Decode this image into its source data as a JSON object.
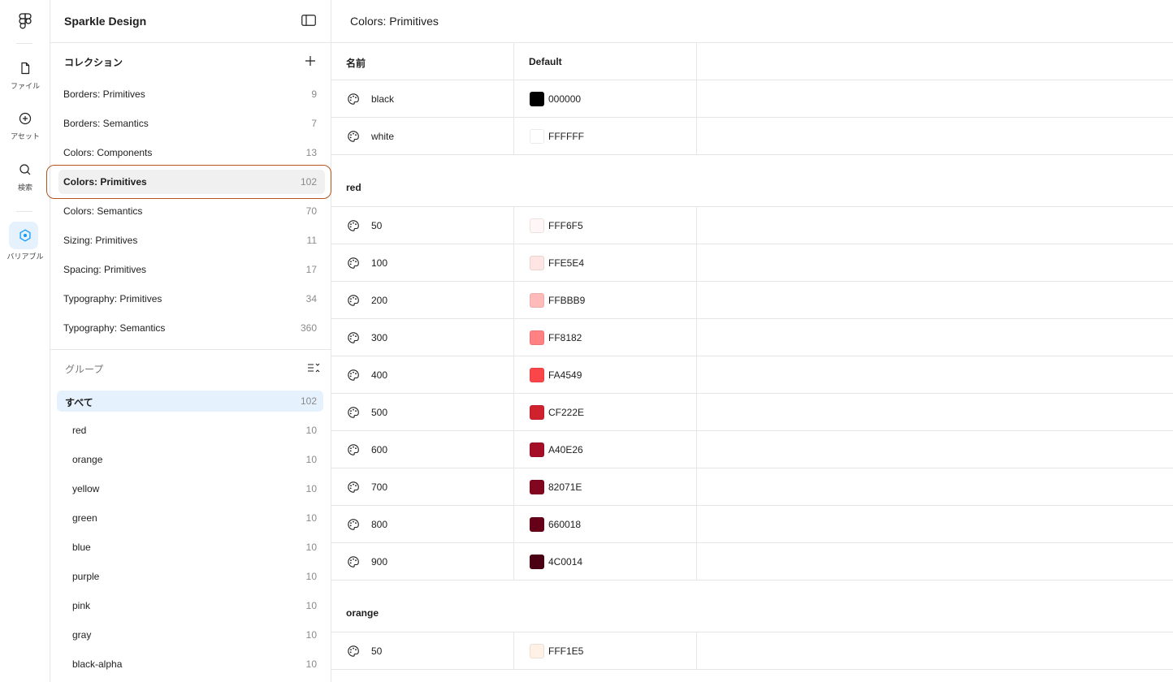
{
  "rail": {
    "items": [
      {
        "label": "ファイル",
        "icon": "file-icon"
      },
      {
        "label": "アセット",
        "icon": "asset-icon"
      },
      {
        "label": "検索",
        "icon": "search-icon"
      },
      {
        "label": "バリアブル",
        "icon": "variables-icon"
      }
    ]
  },
  "panel": {
    "title": "Sparkle Design",
    "collections_title": "コレクション",
    "collections": [
      {
        "name": "Borders: Primitives",
        "count": "9"
      },
      {
        "name": "Borders: Semantics",
        "count": "7"
      },
      {
        "name": "Colors: Components",
        "count": "13"
      },
      {
        "name": "Colors: Primitives",
        "count": "102"
      },
      {
        "name": "Colors: Semantics",
        "count": "70"
      },
      {
        "name": "Sizing: Primitives",
        "count": "11"
      },
      {
        "name": "Spacing: Primitives",
        "count": "17"
      },
      {
        "name": "Typography: Primitives",
        "count": "34"
      },
      {
        "name": "Typography: Semantics",
        "count": "360"
      }
    ],
    "groups_title": "グループ",
    "groups": [
      {
        "name": "すべて",
        "count": "102"
      },
      {
        "name": "red",
        "count": "10"
      },
      {
        "name": "orange",
        "count": "10"
      },
      {
        "name": "yellow",
        "count": "10"
      },
      {
        "name": "green",
        "count": "10"
      },
      {
        "name": "blue",
        "count": "10"
      },
      {
        "name": "purple",
        "count": "10"
      },
      {
        "name": "pink",
        "count": "10"
      },
      {
        "name": "gray",
        "count": "10"
      },
      {
        "name": "black-alpha",
        "count": "10"
      }
    ]
  },
  "main": {
    "title": "Colors: Primitives",
    "columns": {
      "name": "名前",
      "mode": "Default"
    },
    "rows": [
      {
        "name": "black",
        "hex": "000000",
        "color": "#000000"
      },
      {
        "name": "white",
        "hex": "FFFFFF",
        "color": "#FFFFFF"
      }
    ],
    "group_red": "red",
    "red_rows": [
      {
        "name": "50",
        "hex": "FFF6F5",
        "color": "#FFF6F5"
      },
      {
        "name": "100",
        "hex": "FFE5E4",
        "color": "#FFE5E4"
      },
      {
        "name": "200",
        "hex": "FFBBB9",
        "color": "#FFBBB9"
      },
      {
        "name": "300",
        "hex": "FF8182",
        "color": "#FF8182"
      },
      {
        "name": "400",
        "hex": "FA4549",
        "color": "#FA4549"
      },
      {
        "name": "500",
        "hex": "CF222E",
        "color": "#CF222E"
      },
      {
        "name": "600",
        "hex": "A40E26",
        "color": "#A40E26"
      },
      {
        "name": "700",
        "hex": "82071E",
        "color": "#82071E"
      },
      {
        "name": "800",
        "hex": "660018",
        "color": "#660018"
      },
      {
        "name": "900",
        "hex": "4C0014",
        "color": "#4C0014"
      }
    ],
    "group_orange": "orange",
    "orange_rows": [
      {
        "name": "50",
        "hex": "FFF1E5",
        "color": "#FFF1E5"
      }
    ]
  },
  "colors": {
    "accent": "#0d99ff",
    "highlight_ring": "#b5531d",
    "active_group_bg": "#e5f2fd"
  }
}
